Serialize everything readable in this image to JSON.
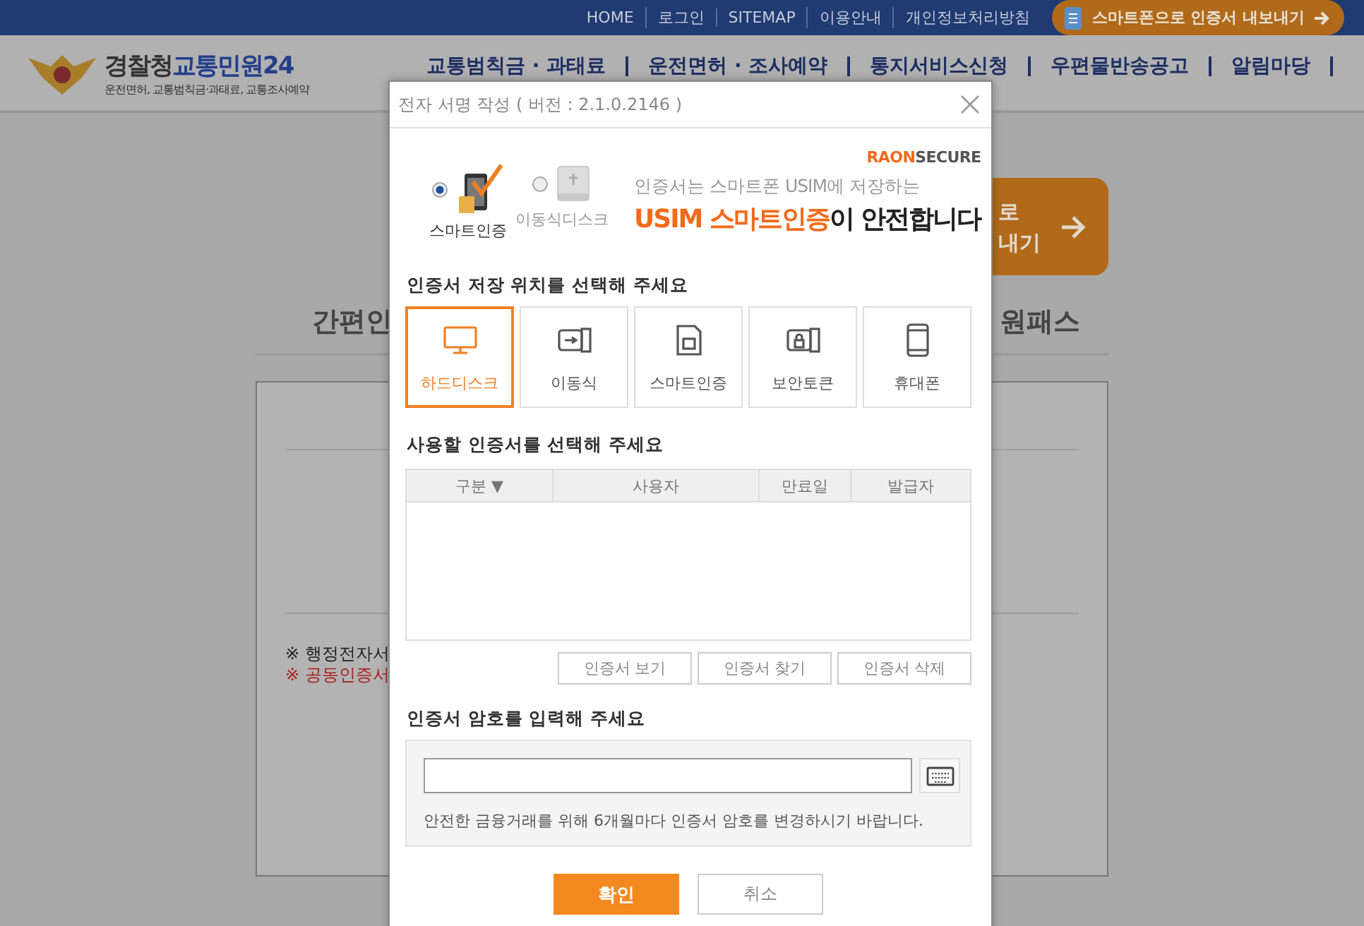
{
  "top_bar": {
    "links": [
      "HOME",
      "로그인",
      "SITEMAP",
      "이용안내",
      "개인정보처리방침"
    ],
    "export_button": "스마트폰으로 인증서 내보내기"
  },
  "logo": {
    "name_dark": "경찰청",
    "name_blue": "교통민원24",
    "subtitle": "운전면허, 교통범칙금·과태료, 교통조사예약"
  },
  "nav": [
    "교통범칙금 · 과태료",
    "운전면허 · 조사예약",
    "통지서비스신청",
    "우편물반송공고",
    "알림마당"
  ],
  "page": {
    "promo_lines": [
      "로",
      "내기"
    ],
    "heading_left": "간편인",
    "heading_right": "원패스",
    "notes": [
      {
        "text": "※ 행정전자서",
        "kind": "plain"
      },
      {
        "text": "※ 공동인증서",
        "kind": "warning"
      }
    ]
  },
  "dialog": {
    "title": "전자 서명 작성 ( 버전 : 2.1.0.2146 )",
    "media": [
      {
        "label": "스마트인증",
        "kind": "phone",
        "selected": true
      },
      {
        "label": "이동식디스크",
        "kind": "disk",
        "selected": false
      }
    ],
    "brand": {
      "part1": "RAON",
      "part2": "SECURE"
    },
    "banner": {
      "line1": "인증서는 스마트폰 USIM에 저장하는",
      "highlight": "USIM 스마트인증",
      "rest": "이 안전합니다"
    },
    "storage_title": "인증서 저장 위치를 선택해 주세요",
    "storage": [
      {
        "label": "하드디스크",
        "kind": "monitor",
        "selected": true
      },
      {
        "label": "이동식",
        "kind": "usb",
        "selected": false
      },
      {
        "label": "스마트인증",
        "kind": "sim",
        "selected": false
      },
      {
        "label": "보안토큰",
        "kind": "token",
        "selected": false
      },
      {
        "label": "휴대폰",
        "kind": "phone",
        "selected": false
      }
    ],
    "cert_title": "사용할 인증서를 선택해 주세요",
    "columns": [
      "구분 ▼",
      "사용자",
      "만료일",
      "발급자"
    ],
    "cert_buttons": [
      "인증서 보기",
      "인증서 찾기",
      "인증서 삭제"
    ],
    "password_title": "인증서 암호를 입력해 주세요",
    "password_note": "안전한 금융거래를 위해 6개월마다 인증서 암호를 변경하시기 바랍니다.",
    "ok": "확인",
    "cancel": "취소"
  }
}
